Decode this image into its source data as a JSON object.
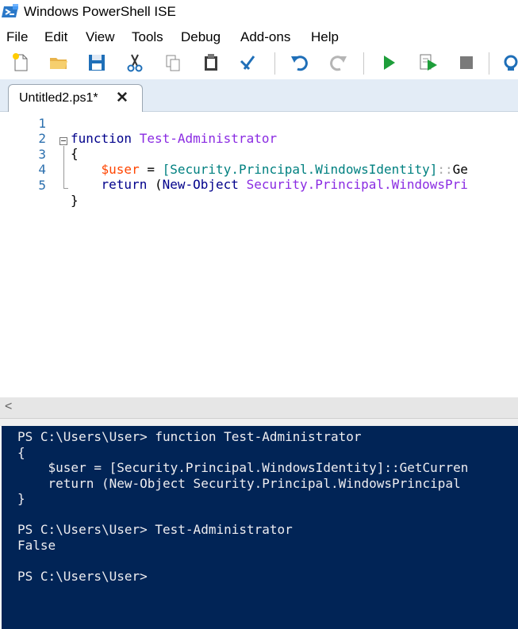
{
  "window": {
    "title": "Windows PowerShell ISE",
    "icon": "powershell-ise-icon"
  },
  "menu": {
    "items": [
      "File",
      "Edit",
      "View",
      "Tools",
      "Debug",
      "Add-ons",
      "Help"
    ]
  },
  "toolbar": {
    "buttons": [
      "new-script-icon",
      "open-icon",
      "save-icon",
      "cut-icon",
      "copy-icon",
      "paste-icon",
      "clear-console-icon",
      "undo-icon",
      "redo-icon",
      "run-script-icon",
      "run-selection-icon",
      "stop-icon",
      "new-remote-tab-icon"
    ]
  },
  "tabs": [
    {
      "label": "Untitled2.ps1*",
      "close": "✕"
    }
  ],
  "editor": {
    "line_numbers": [
      "1",
      "2",
      "3",
      "4",
      "5"
    ],
    "lines": {
      "l1": {
        "kw": "function",
        "name": "Test-Administrator"
      },
      "l2": {
        "brace": "{"
      },
      "l3": {
        "var": "$user",
        "eq": "=",
        "type": "[Security.Principal.WindowsIdentity]",
        "op": "::",
        "rest": "Ge"
      },
      "l4": {
        "kw": "return",
        "paren": "(",
        "cmd": "New-Object",
        "arg": "Security.Principal.WindowsPri"
      },
      "l5": {
        "brace": "}"
      }
    }
  },
  "scrollbar": {
    "left_arrow": "<"
  },
  "console": {
    "lines": [
      "PS C:\\Users\\User> function Test-Administrator",
      "{",
      "    $user = [Security.Principal.WindowsIdentity]::GetCurren",
      "    return (New-Object Security.Principal.WindowsPrincipal",
      "}",
      "",
      "PS C:\\Users\\User> Test-Administrator",
      "False",
      "",
      "PS C:\\Users\\User>"
    ]
  },
  "colors": {
    "console_bg": "#012456",
    "console_fg": "#eeedf0",
    "keyword": "#00008b",
    "function_name": "#8a2be2",
    "variable": "#ff4500",
    "type": "#008080",
    "line_number": "#2b6fae"
  }
}
